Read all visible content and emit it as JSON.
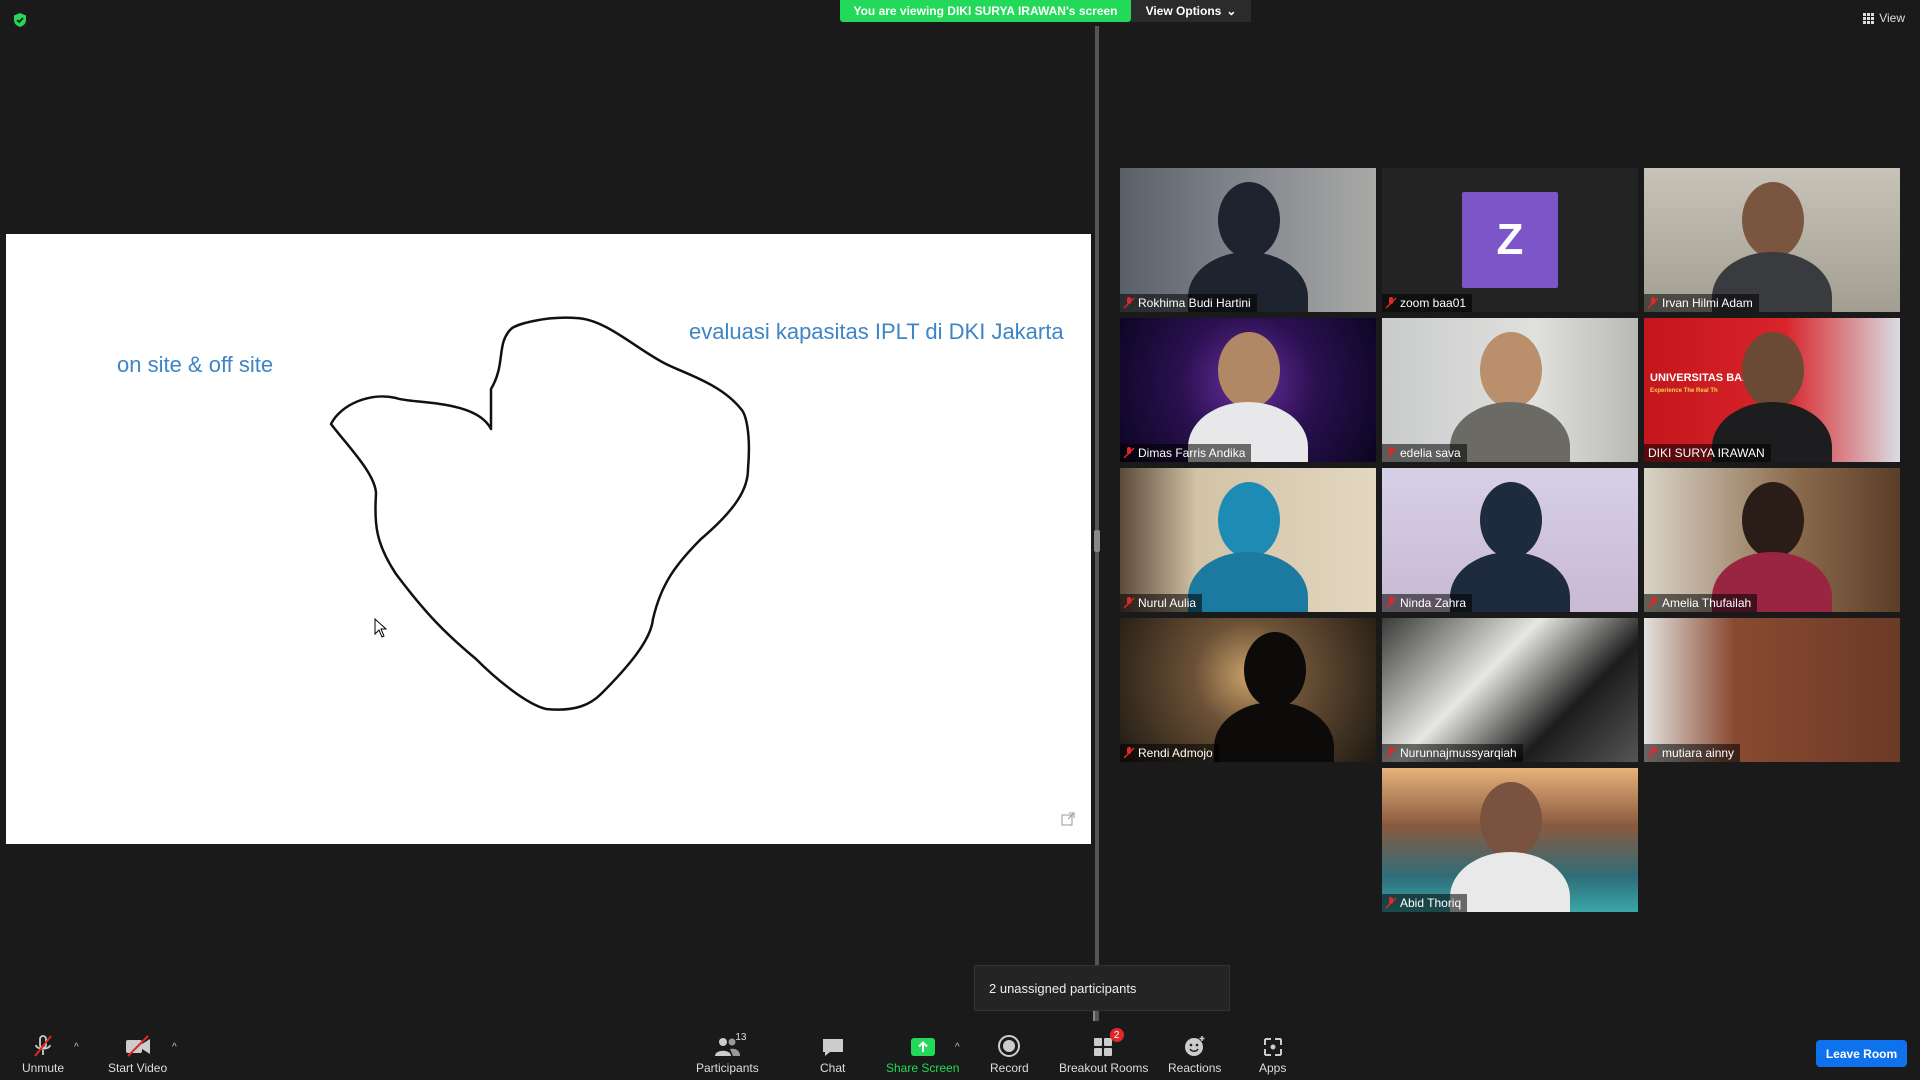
{
  "header": {
    "viewing_banner": "You are viewing DIKI SURYA IRAWAN's screen",
    "view_options": "View Options",
    "view_button": "View"
  },
  "shared_screen": {
    "text_left": "on site & off site",
    "text_right": "evaluasi kapasitas IPLT di DKI Jakarta"
  },
  "participants": [
    {
      "name": "Rokhima Budi Hartini",
      "muted": true
    },
    {
      "name": "zoom baa01",
      "muted": true,
      "avatar_letter": "Z"
    },
    {
      "name": "Irvan Hilmi Adam",
      "muted": true
    },
    {
      "name": "Dimas Farris Andika",
      "muted": true
    },
    {
      "name": "edelia sava",
      "muted": true
    },
    {
      "name": "DIKI SURYA IRAWAN",
      "muted": false,
      "active_speaker": true,
      "banner": "UNIVERSITAS BAKRIE",
      "banner_sub": "Experience The Real Th"
    },
    {
      "name": "Nurul Aulia",
      "muted": true
    },
    {
      "name": "Ninda Zahra",
      "muted": true
    },
    {
      "name": "Amelia Thufailah",
      "muted": true
    },
    {
      "name": "Rendi Admojo",
      "muted": true
    },
    {
      "name": "Nurunnajmussyarqiah",
      "muted": true
    },
    {
      "name": "mutiara ainny",
      "muted": true
    },
    {
      "name": "Abid Thoriq",
      "muted": true
    }
  ],
  "unassigned": "2 unassigned participants",
  "toolbar": {
    "unmute": "Unmute",
    "start_video": "Start Video",
    "participants": "Participants",
    "participants_count": "13",
    "chat": "Chat",
    "share_screen": "Share Screen",
    "record": "Record",
    "breakout_rooms": "Breakout Rooms",
    "breakout_badge": "2",
    "reactions": "Reactions",
    "apps": "Apps",
    "leave_room": "Leave Room"
  },
  "colors": {
    "banner_green": "#23d959",
    "active_speaker_border": "#f7e47a",
    "leave_blue": "#0e72ed",
    "avatar_purple": "#7c55c8",
    "annotation_text": "#3d85c6"
  }
}
